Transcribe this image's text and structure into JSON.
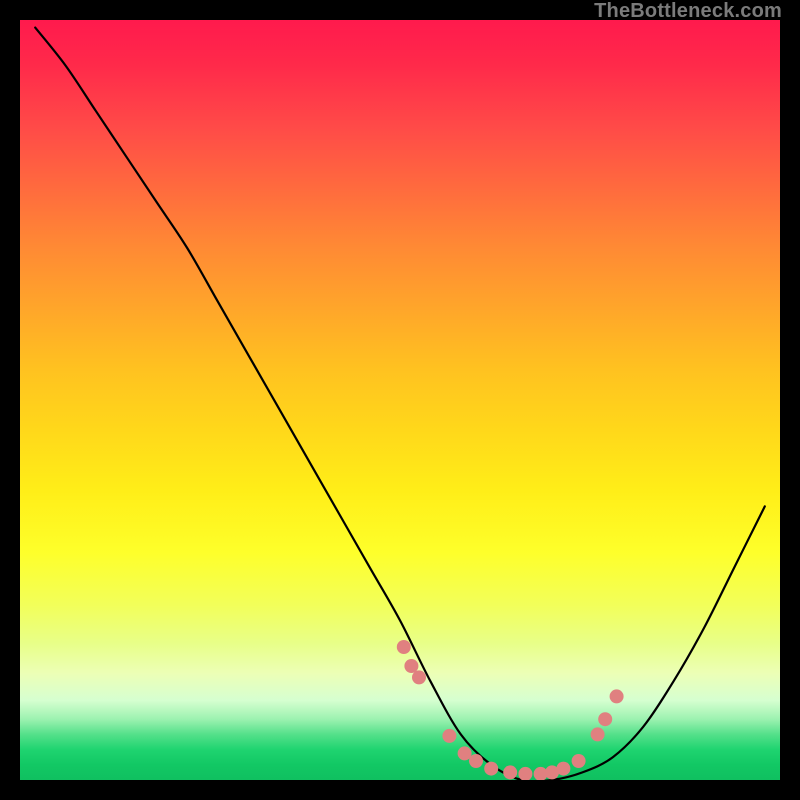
{
  "watermark": "TheBottleneck.com",
  "colors": {
    "background": "#000000",
    "curve": "#000000",
    "dots": "#e08080"
  },
  "chart_data": {
    "type": "line",
    "title": "",
    "xlabel": "",
    "ylabel": "",
    "xlim": [
      0,
      100
    ],
    "ylim": [
      0,
      100
    ],
    "grid": false,
    "annotations": [],
    "series": [
      {
        "name": "bottleneck-curve",
        "x": [
          2,
          6,
          10,
          14,
          18,
          22,
          26,
          30,
          34,
          38,
          42,
          46,
          50,
          54,
          58,
          62,
          66,
          70,
          74,
          78,
          82,
          86,
          90,
          94,
          98
        ],
        "y": [
          99,
          94,
          88,
          82,
          76,
          70,
          63,
          56,
          49,
          42,
          35,
          28,
          21,
          13,
          6,
          2,
          0,
          0,
          1,
          3,
          7,
          13,
          20,
          28,
          36
        ]
      }
    ],
    "highlight_points": {
      "name": "dots",
      "x": [
        50.5,
        51.5,
        52.5,
        56.5,
        58.5,
        60.0,
        62.0,
        64.5,
        66.5,
        68.5,
        70.0,
        71.5,
        73.5,
        76.0,
        77.0,
        78.5
      ],
      "y": [
        17.5,
        15.0,
        13.5,
        5.8,
        3.5,
        2.5,
        1.5,
        1.0,
        0.8,
        0.8,
        1.0,
        1.5,
        2.5,
        6.0,
        8.0,
        11.0
      ]
    }
  }
}
